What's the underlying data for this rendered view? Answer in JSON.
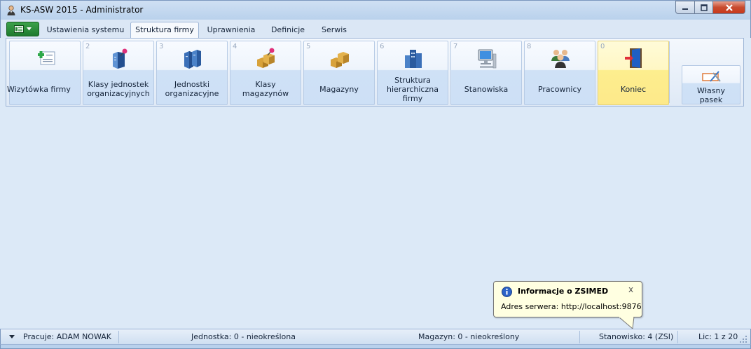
{
  "window": {
    "title": "KS-ASW 2015 - Administrator",
    "icons": {
      "app": "user-figure-icon",
      "minimize": "minimize-icon",
      "maximize": "maximize-icon",
      "close": "close-icon"
    }
  },
  "tabs": [
    {
      "label": "Ustawienia systemu",
      "active": false
    },
    {
      "label": "Struktura firmy",
      "active": true
    },
    {
      "label": "Uprawnienia",
      "active": false
    },
    {
      "label": "Definicje",
      "active": false
    },
    {
      "label": "Serwis",
      "active": false
    }
  ],
  "ribbon": {
    "buttons": [
      {
        "num": "",
        "label": "Wizytówka firmy",
        "icon": "business-card-icon"
      },
      {
        "num": "2",
        "label": "Klasy jednostek organizacyjnych",
        "icon": "server-pin-icon"
      },
      {
        "num": "3",
        "label": "Jednostki organizacyjne",
        "icon": "servers-icon"
      },
      {
        "num": "4",
        "label": "Klasy magazynów",
        "icon": "boxes-pin-icon"
      },
      {
        "num": "5",
        "label": "Magazyny",
        "icon": "boxes-icon"
      },
      {
        "num": "6",
        "label": "Struktura hierarchiczna firmy",
        "icon": "buildings-icon"
      },
      {
        "num": "7",
        "label": "Stanowiska",
        "icon": "computer-icon"
      },
      {
        "num": "8",
        "label": "Pracownicy",
        "icon": "people-icon"
      },
      {
        "num": "0",
        "label": "Koniec",
        "icon": "exit-door-icon",
        "highlight": "#fdee8e"
      }
    ],
    "own_toolbar": {
      "label": "Własny pasek",
      "icon": "custom-toolbar-icon"
    }
  },
  "balloon": {
    "title": "Informacje o ZSIMED",
    "text": "Adres serwera: http://localhost:9876",
    "icon": "info-icon",
    "close": "x"
  },
  "statusbar": {
    "user": "Pracuje: ADAM NOWAK",
    "unit": "Jednostka: 0 - nieokreślona",
    "warehouse": "Magazyn: 0 - nieokreślony",
    "workstation": "Stanowisko: 4 (ZSI)",
    "license": "Lic: 1 z 20"
  },
  "colors": {
    "accent_green": "#1e7a2e",
    "ribbon_blue": "#cfe1f6",
    "highlight_yellow": "#fdee8e",
    "tooltip_bg": "#ffffe1"
  }
}
